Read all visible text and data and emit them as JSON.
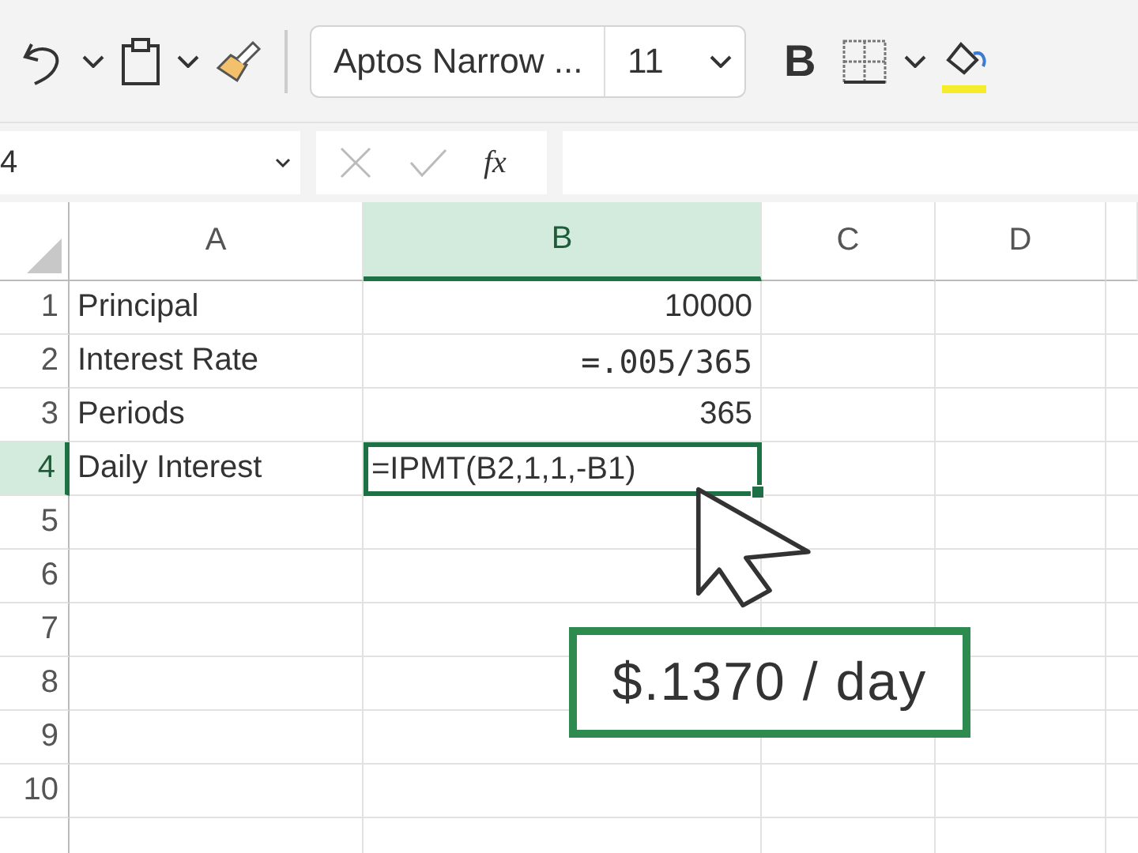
{
  "toolbar": {
    "font": "Aptos Narrow ...",
    "size": "11",
    "bold": "B"
  },
  "formula_bar": {
    "name_box": "4",
    "function_label": "fx"
  },
  "columns": [
    {
      "label": "A",
      "selected": false
    },
    {
      "label": "B",
      "selected": true
    },
    {
      "label": "C",
      "selected": false
    },
    {
      "label": "D",
      "selected": false
    }
  ],
  "rows": [
    {
      "number": "1",
      "selected": false,
      "cells": [
        {
          "kind": "text",
          "value": "Principal"
        },
        {
          "kind": "number",
          "value": "10000"
        }
      ]
    },
    {
      "number": "2",
      "selected": false,
      "cells": [
        {
          "kind": "text",
          "value": "Interest Rate"
        },
        {
          "kind": "mono",
          "value": "=.005/365"
        }
      ]
    },
    {
      "number": "3",
      "selected": false,
      "cells": [
        {
          "kind": "text",
          "value": "Periods"
        },
        {
          "kind": "number",
          "value": "365"
        }
      ]
    },
    {
      "number": "4",
      "selected": true,
      "cells": [
        {
          "kind": "text",
          "value": "Daily Interest"
        },
        {
          "kind": "text",
          "value": "=IPMT(B2,1,1,-B1)",
          "selected": true
        }
      ]
    },
    {
      "number": "5",
      "selected": false,
      "cells": []
    },
    {
      "number": "6",
      "selected": false,
      "cells": []
    },
    {
      "number": "7",
      "selected": false,
      "cells": []
    },
    {
      "number": "8",
      "selected": false,
      "cells": []
    },
    {
      "number": "9",
      "selected": false,
      "cells": []
    },
    {
      "number": "10",
      "selected": false,
      "cells": []
    }
  ],
  "callout": {
    "text": "$.1370 / day"
  }
}
